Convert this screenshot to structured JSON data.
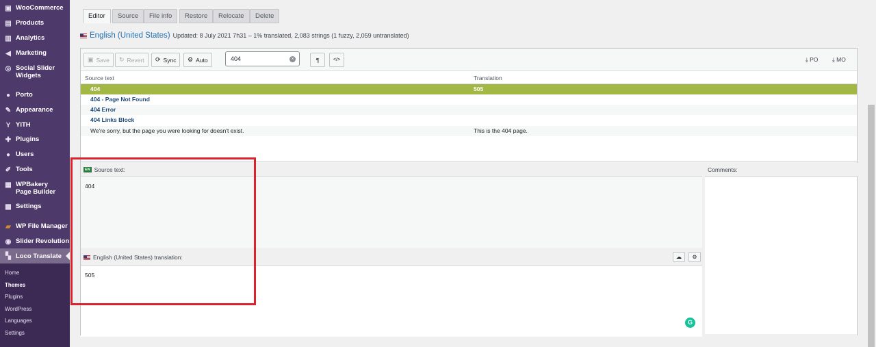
{
  "sidebar": {
    "items": [
      {
        "label": "WooCommerce",
        "icon": "woo-icon"
      },
      {
        "label": "Products",
        "icon": "box-icon"
      },
      {
        "label": "Analytics",
        "icon": "chart-icon"
      },
      {
        "label": "Marketing",
        "icon": "megaphone-icon"
      },
      {
        "label": "Social Slider Widgets",
        "icon": "social-icon"
      },
      {
        "label": "Porto",
        "icon": "porto-icon"
      },
      {
        "label": "Appearance",
        "icon": "brush-icon"
      },
      {
        "label": "YITH",
        "icon": "yith-icon"
      },
      {
        "label": "Plugins",
        "icon": "plug-icon"
      },
      {
        "label": "Users",
        "icon": "user-icon"
      },
      {
        "label": "Tools",
        "icon": "wrench-icon"
      },
      {
        "label": "WPBakery Page Builder",
        "icon": "builder-icon"
      },
      {
        "label": "Settings",
        "icon": "settings-icon"
      },
      {
        "label": "WP File Manager",
        "icon": "folder-icon"
      },
      {
        "label": "Slider Revolution",
        "icon": "refresh-icon"
      },
      {
        "label": "Loco Translate",
        "icon": "translate-icon"
      }
    ],
    "submenu": [
      "Home",
      "Themes",
      "Plugins",
      "WordPress",
      "Languages",
      "Settings"
    ]
  },
  "tabs": [
    "Editor",
    "Source",
    "File info",
    "Restore",
    "Relocate",
    "Delete"
  ],
  "header": {
    "language": "English (United States)",
    "status": "Updated: 8 July 2021 7h31 – 1% translated, 2,083 strings (1 fuzzy, 2,059 untranslated)"
  },
  "toolbar": {
    "save": "Save",
    "revert": "Revert",
    "sync": "Sync",
    "auto": "Auto",
    "search_value": "404",
    "pilcrow": "¶",
    "code": "</>",
    "po": "PO",
    "mo": "MO"
  },
  "table": {
    "headers": [
      "Source text",
      "Translation"
    ],
    "rows": [
      {
        "source": "404",
        "translation": "505"
      },
      {
        "source": "404 - Page Not Found",
        "translation": ""
      },
      {
        "source": "404 Error",
        "translation": ""
      },
      {
        "source": "404 Links Block",
        "translation": ""
      },
      {
        "source": "We're sorry, but the page you were looking for doesn't exist.",
        "translation": "This is the 404 page."
      }
    ]
  },
  "editor": {
    "source_label": "Source text:",
    "source_badge": "EN",
    "source_value": "404",
    "translation_label": "English (United States) translation:",
    "translation_value": "505",
    "comments_label": "Comments:",
    "grammarly": "G"
  },
  "colors": {
    "sidebar_bg": "#4e3a6a",
    "selected_row": "#a3b745",
    "highlight_box": "#d9232d",
    "link": "#2271b1"
  }
}
